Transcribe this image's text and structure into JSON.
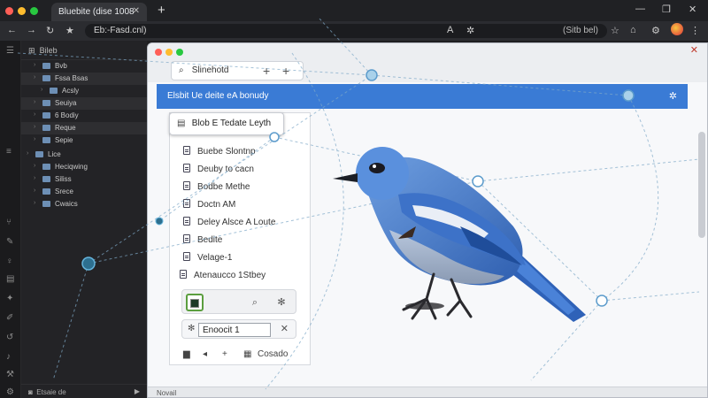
{
  "browser": {
    "tab_title": "Bluebite (dise 1008",
    "address": "Eb:-Fasd.cnl)",
    "omnibox_right": "(Sitb bel)"
  },
  "sidebar": {
    "header": "Bileb",
    "items": [
      {
        "label": "Bvb",
        "indent": 1
      },
      {
        "label": "Fssa Bsas",
        "indent": 1
      },
      {
        "label": "Acsly",
        "indent": 2
      },
      {
        "label": "Seuiya",
        "indent": 1
      },
      {
        "label": "6 Bodiy",
        "indent": 1
      },
      {
        "label": "Reque",
        "indent": 1
      },
      {
        "label": "Sepie",
        "indent": 1
      },
      {
        "label": "Lice",
        "indent": 0
      },
      {
        "label": "Heciqwing",
        "indent": 1
      },
      {
        "label": "Siliss",
        "indent": 1
      },
      {
        "label": "Srece",
        "indent": 1
      },
      {
        "label": "Cwaics",
        "indent": 1
      }
    ],
    "footer": "Etsaie de"
  },
  "window": {
    "search_tab": "Slinehotd",
    "header_title": "Elsbit Ue deite eA bonudy",
    "dropdown_label": "Blob E Tedate Leyth",
    "doc_items": [
      "Buebe Slontnp",
      "Deuby to cacn",
      "Bodbe Methe",
      "Doctn AM",
      "Deley Alsce A Loute",
      "Bedite",
      "Velage-1",
      "Atenaucco 1Stbey"
    ],
    "input_value": "Enoocit 1",
    "bottom_label": "Cosado",
    "status": "Novail"
  },
  "colors": {
    "accent_blue": "#3a7bd5",
    "active_tool_border": "#5b9e3f",
    "bird_blue": "#4f86d3"
  }
}
